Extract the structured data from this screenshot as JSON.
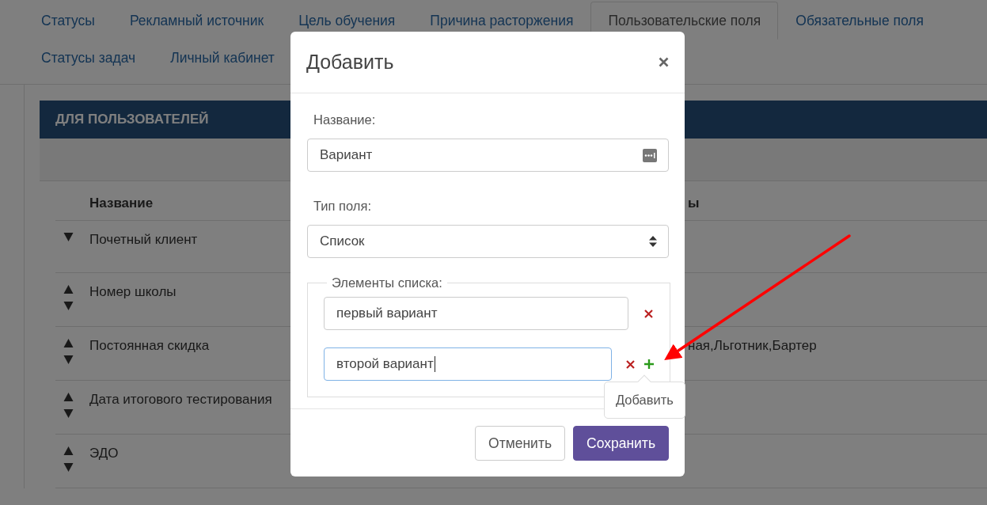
{
  "tabs": [
    {
      "label": "Статусы",
      "selected": false
    },
    {
      "label": "Рекламный источник",
      "selected": false
    },
    {
      "label": "Цель обучения",
      "selected": false
    },
    {
      "label": "Причина расторжения",
      "selected": false
    },
    {
      "label": "Пользовательские поля",
      "selected": true
    },
    {
      "label": "Обязательные поля",
      "selected": false
    },
    {
      "label": "Статусы задач",
      "selected": false
    },
    {
      "label": "Личный кабинет",
      "selected": false
    }
  ],
  "section": {
    "title": "ДЛЯ ПОЛЬЗОВАТЕЛЕЙ"
  },
  "table": {
    "columns": [
      {
        "label": "Название"
      },
      {
        "label": "ы"
      }
    ],
    "rows": [
      {
        "name": "Почетный клиент",
        "up": false,
        "down": true,
        "column_3": ""
      },
      {
        "name": "Номер школы",
        "up": true,
        "down": true,
        "column_3": ""
      },
      {
        "name": "Постоянная скидка",
        "up": true,
        "down": true,
        "column_3": "ная,Льготник,Бартер"
      },
      {
        "name": "Дата итогового тестирования",
        "up": true,
        "down": true,
        "column_3": ""
      },
      {
        "name": "ЭДО",
        "up": true,
        "down": true,
        "column_3": ""
      }
    ]
  },
  "modal": {
    "title": "Добавить",
    "name_field": {
      "label": "Название:",
      "value": "Вариант"
    },
    "type_field": {
      "label": "Тип поля:",
      "value": "Список"
    },
    "list": {
      "legend": "Элементы списка:",
      "items": [
        {
          "value": "первый вариант",
          "focused": false,
          "can_add": false
        },
        {
          "value": "второй вариант",
          "focused": true,
          "can_add": true
        }
      ]
    },
    "tooltip": "Добавить",
    "buttons": [
      {
        "label": "Отменить",
        "kind": "secondary"
      },
      {
        "label": "Сохранить",
        "kind": "primary"
      }
    ]
  }
}
